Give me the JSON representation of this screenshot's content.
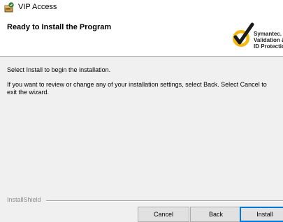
{
  "window": {
    "title": "VIP Access",
    "icon": "installer-package-icon"
  },
  "header": {
    "title": "Ready to Install the Program",
    "logo": {
      "icon": "symantec-checkmark-icon",
      "lines": [
        "Symantec.",
        "Validation &",
        "ID Protectio"
      ],
      "colors": {
        "ring": "#f5b80f",
        "check": "#1a1a1a"
      }
    }
  },
  "body": {
    "line1": "Select Install to begin the installation.",
    "line2": "If you want to review or change any of your installation settings, select Back. Select Cancel to exit the wizard."
  },
  "footer": {
    "brand": "InstallShield",
    "buttons": {
      "cancel": "Cancel",
      "back": "Back",
      "install": "Install"
    }
  },
  "colors": {
    "background": "#f0f0f0",
    "header_bg": "#ffffff",
    "default_button_border": "#0078d7"
  }
}
